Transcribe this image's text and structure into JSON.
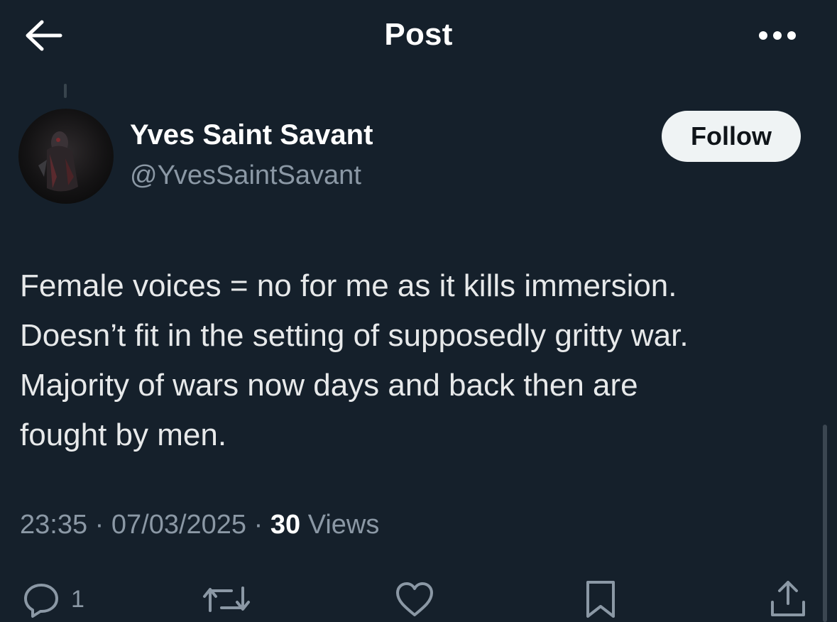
{
  "header": {
    "back_icon": "arrow-left-icon",
    "title": "Post",
    "more_icon": "more-horizontal-icon"
  },
  "author": {
    "display_name": "Yves Saint Savant",
    "handle": "@YvesSaintSavant",
    "follow_label": "Follow"
  },
  "post": {
    "lines": [
      "Female voices = no for me as it kills immersion.",
      "Doesn’t fit in the setting of supposedly gritty war.",
      "Majority of wars now days and back then are",
      "fought by men."
    ]
  },
  "meta": {
    "time": "23:35",
    "separator": "·",
    "date": "07/03/2025",
    "views_count": "30",
    "views_label": "Views"
  },
  "actions": {
    "reply_icon": "reply-icon",
    "reply_count": "1",
    "repost_icon": "repost-icon",
    "like_icon": "heart-icon",
    "bookmark_icon": "bookmark-icon",
    "share_icon": "share-icon"
  },
  "colors": {
    "background": "#15202b",
    "secondary_text": "#8b98a5",
    "follow_button_bg": "#eff3f4",
    "follow_button_text": "#0f1419"
  }
}
